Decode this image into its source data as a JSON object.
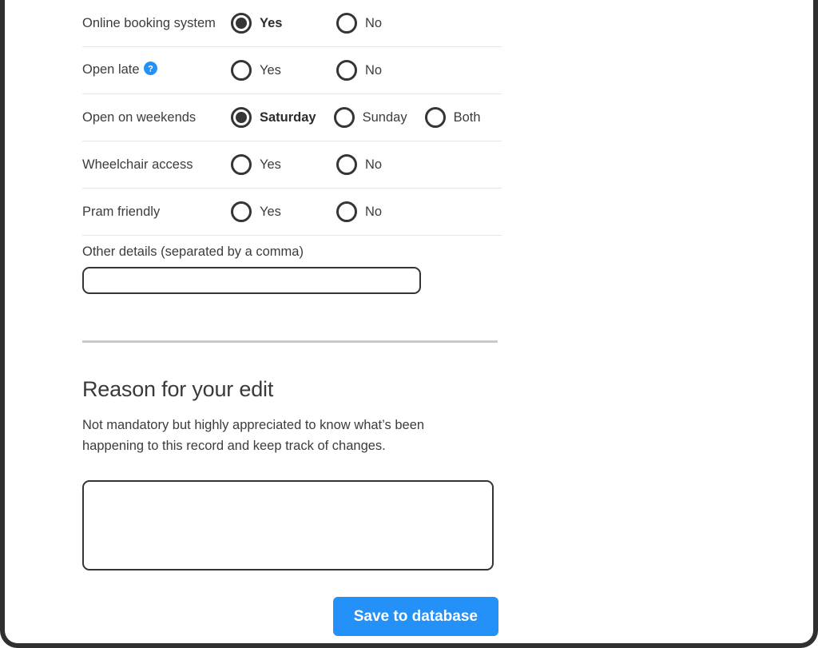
{
  "form": {
    "rows": [
      {
        "label": "Online booking system",
        "has_help_icon": false,
        "options": [
          {
            "label": "Yes",
            "selected": true
          },
          {
            "label": "No",
            "selected": false
          }
        ]
      },
      {
        "label": "Open late",
        "has_help_icon": true,
        "help_icon": "question-mark-circle-icon",
        "options": [
          {
            "label": "Yes",
            "selected": false
          },
          {
            "label": "No",
            "selected": false
          }
        ]
      },
      {
        "label": "Open on weekends",
        "has_help_icon": false,
        "options": [
          {
            "label": "Saturday",
            "selected": true
          },
          {
            "label": "Sunday",
            "selected": false
          },
          {
            "label": "Both",
            "selected": false
          }
        ]
      },
      {
        "label": "Wheelchair access",
        "has_help_icon": false,
        "options": [
          {
            "label": "Yes",
            "selected": false
          },
          {
            "label": "No",
            "selected": false
          }
        ]
      },
      {
        "label": "Pram friendly",
        "has_help_icon": false,
        "options": [
          {
            "label": "Yes",
            "selected": false
          },
          {
            "label": "No",
            "selected": false
          }
        ]
      }
    ],
    "other_details": {
      "label": "Other details (separated by a comma)",
      "value": "",
      "placeholder": ""
    }
  },
  "reason_section": {
    "title": "Reason for your edit",
    "description": "Not mandatory but highly appreciated to know what’s been happening to this record and keep track of changes.",
    "textarea_value": "",
    "textarea_placeholder": ""
  },
  "actions": {
    "save_label": "Save to database"
  },
  "colors": {
    "accent_blue": "#2391f7",
    "help_icon_blue": "#2391f7",
    "text": "#3c3c3c",
    "control_border": "#343434",
    "divider": "#e4e6e8",
    "section_rule": "#c9c9c9",
    "frame": "#2f2f2f"
  }
}
